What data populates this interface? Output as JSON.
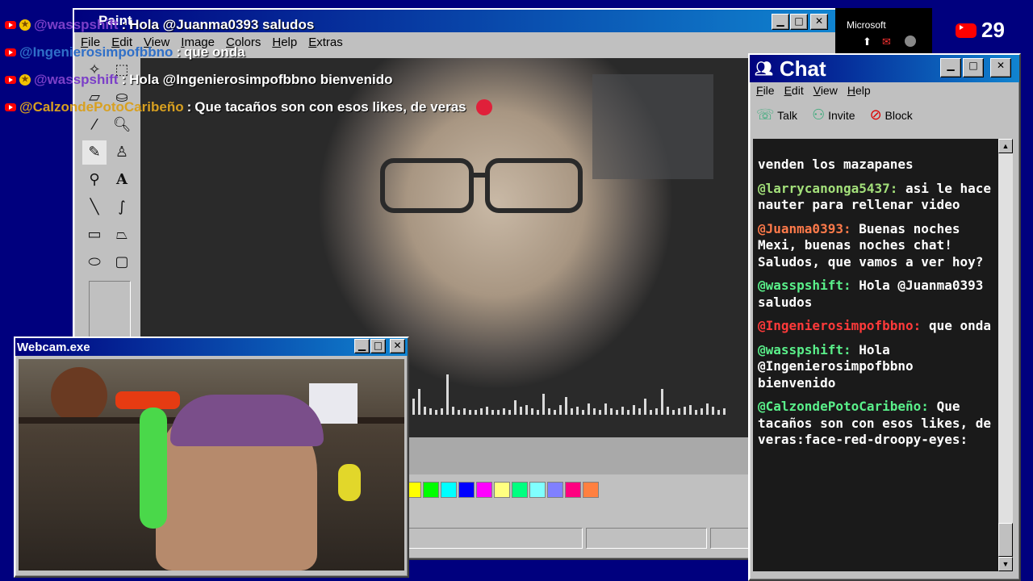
{
  "paint": {
    "title": "Paint",
    "menu": [
      "File",
      "Edit",
      "View",
      "Image",
      "Colors",
      "Help",
      "Extras"
    ],
    "palette": [
      "#ffff00",
      "#00ff00",
      "#00ffff",
      "#0000ff",
      "#ff00ff",
      "#ffff80",
      "#00ff80",
      "#80ffff",
      "#8080ff",
      "#ff0080",
      "#ff8040"
    ]
  },
  "overlay_chat": [
    {
      "user": "@wasspshift",
      "text": "Hola @Juanma0393 saludos",
      "user_color": "#7b3fc8",
      "badge": true
    },
    {
      "user": "@Ingenierosimpofbbno",
      "text": "que onda",
      "user_color": "#2f6fc8",
      "badge": false
    },
    {
      "user": "@wasspshift",
      "text": "Hola @Ingenierosimpofbbno bienvenido",
      "user_color": "#7b3fc8",
      "badge": true
    },
    {
      "user": "@CalzondePotoCaribeño",
      "text": "Que tacaños son con esos likes, de veras",
      "user_color": "#d8a020",
      "badge": false
    }
  ],
  "chat": {
    "title": "Chat",
    "menu": [
      "File",
      "Edit",
      "View",
      "Help"
    ],
    "toolbar": {
      "talk": "Talk",
      "invite": "Invite",
      "block": "Block"
    },
    "messages": [
      {
        "user": "",
        "text": "venden los mazapanes",
        "user_color": "#ffffff"
      },
      {
        "user": "@larrycanonga5437:",
        "text": "asi le hace nauter para rellenar video",
        "user_color": "#a3e07a"
      },
      {
        "user": "@Juanma0393:",
        "text": "Buenas noches Mexi, buenas noches chat! Saludos, que vamos a ver hoy?",
        "user_color": "#ff7a4a"
      },
      {
        "user": "@wasspshift:",
        "text": "Hola @Juanma0393 saludos",
        "user_color": "#5af08a"
      },
      {
        "user": "@Ingenierosimpofbbno:",
        "text": "que onda",
        "user_color": "#ff3a3a"
      },
      {
        "user": "@wasspshift:",
        "text": "Hola @Ingenierosimpofbbno bienvenido",
        "user_color": "#5af08a"
      },
      {
        "user": "@CalzondePotoCaribeño:",
        "text": "Que tacaños son con esos likes, de veras:face-red-droopy-eyes:",
        "user_color": "#5af08a"
      }
    ]
  },
  "webcam": {
    "title": "Webcam.exe"
  },
  "topright": {
    "ms_label": "Microsoft",
    "viewer_count": "29"
  },
  "colors": {
    "title_blue": "#00007e",
    "desktop": "#00007e",
    "win_gray": "#c0c0c0"
  }
}
